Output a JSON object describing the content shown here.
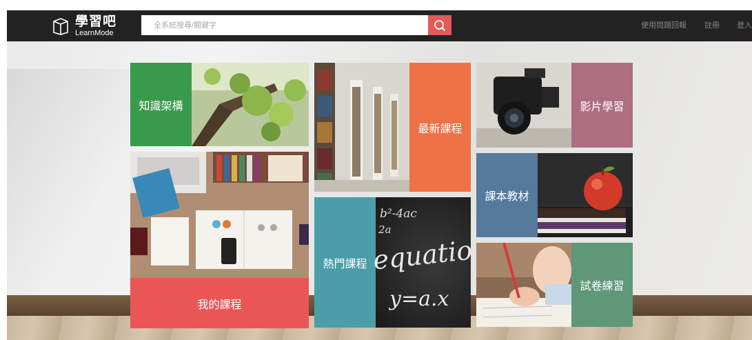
{
  "header": {
    "logo_cn": "學習吧",
    "logo_en": "LearnMode",
    "search_placeholder": "全系統搜尋/關鍵字",
    "nav": [
      "使用問題回報",
      "註冊",
      "登入"
    ]
  },
  "tiles": {
    "knowledge": "知識架構",
    "newest": "最新課程",
    "video": "影片學習",
    "mycourses": "我的課程",
    "popular": "熱門課程",
    "textbooks": "課本教材",
    "exam": "試卷練習"
  },
  "chalkboard": {
    "line1": "b²-4ac",
    "line2": "2a",
    "line3": "equatio",
    "line4": "y=a.x"
  },
  "colors": {
    "topbar": "#222222",
    "search_button": "#e35a5a",
    "green": "#3a9a4c",
    "orange": "#ef7146",
    "mauve": "#ad6e82",
    "red": "#ea5656",
    "teal": "#4b9da8",
    "blue": "#557a9c",
    "sage": "#5f9779"
  }
}
